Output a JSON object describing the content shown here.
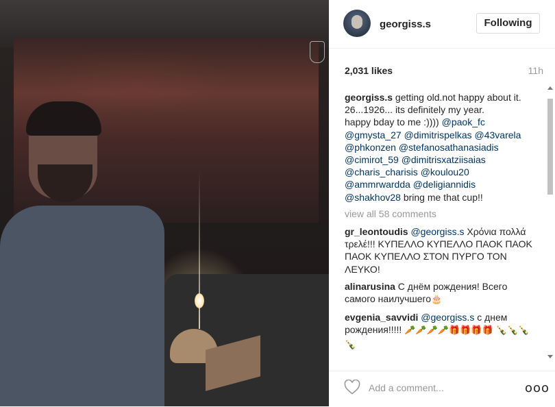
{
  "post": {
    "username": "georgiss.s",
    "follow_label": "Following",
    "likes": "2,031 likes",
    "time": "11h"
  },
  "caption": {
    "username": "georgiss.s",
    "text1": " getting old.not happy about it.",
    "text2": "26...1926... its definitely my year.",
    "text3": "happy bday to me :)))) ",
    "mentions": [
      "@paok_fc",
      "@gmysta_27",
      "@dimitrispelkas",
      "@43varela",
      "@phkonzen",
      "@stefanosathanasiadis",
      "@cimirot_59",
      "@dimitrisxatziisaias",
      "@charis_charisis",
      "@koulou20",
      "@ammrwardda",
      "@deligiannidis",
      "@shakhov28"
    ],
    "tail": " bring me that cup!!"
  },
  "view_all": "view all 58 comments",
  "comments": [
    {
      "user": "gr_leontoudis",
      "mention": "@georgiss.s",
      "text": " Χρόνια πολλά τρελέ!!! ΚΥΠΕΛΛΟ ΚΥΠΕΛΛΟ ΠΑΟΚ ΠΑΟΚ ΠΑΟΚ ΚΥΠΕΛΛΟ ΣΤΟΝ ΠΥΡΓΟ ΤΟΝ ΛΕΥΚΟ!"
    },
    {
      "user": "alinarusina",
      "mention": "",
      "text": " С днём рождения! Всего самого наилучшего",
      "emoji": "🎂"
    },
    {
      "user": "evgenia_savvidi",
      "mention": "@georgiss.s",
      "text": " с днем рождения!!!!! ",
      "emoji": "🥕🥕🥕🥕🎁🎁🎁🎁 🍾🍾🍾🍾"
    }
  ],
  "comment_box": {
    "placeholder": "Add a comment...",
    "more": "ooo"
  },
  "icons": {
    "heart": "heart-icon",
    "more": "more-icon",
    "avatar": "avatar"
  },
  "colors": {
    "mention": "#003569",
    "muted": "#999999",
    "border": "#efefef"
  }
}
